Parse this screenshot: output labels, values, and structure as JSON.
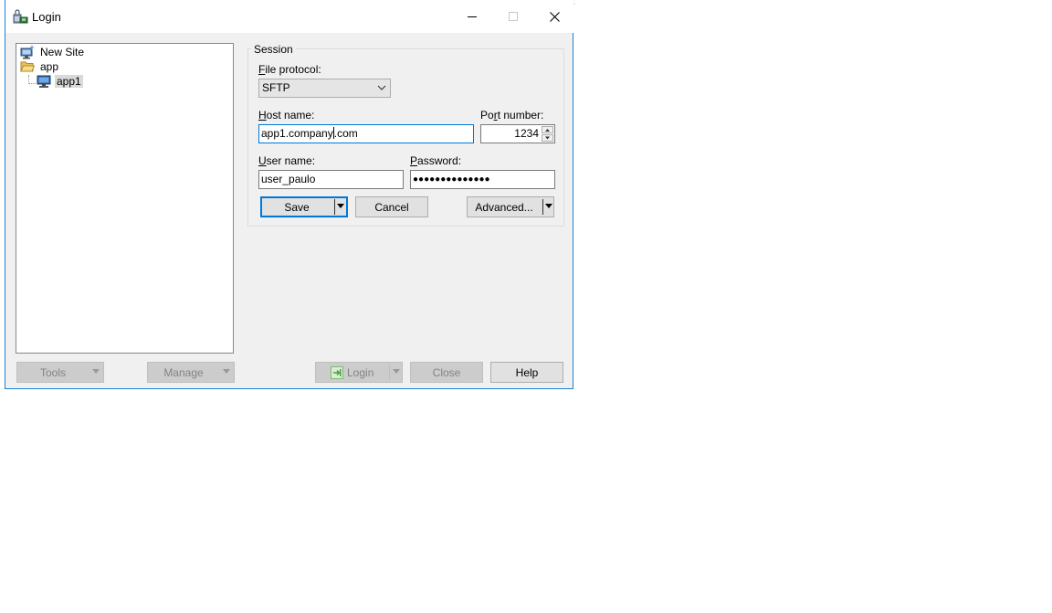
{
  "window": {
    "title": "Login",
    "minimize_icon": "minimize-icon",
    "maximize_icon": "maximize-icon",
    "close_icon": "close-icon"
  },
  "site_tree": {
    "items": [
      {
        "label": "New Site",
        "icon": "new-site-icon",
        "level": 0,
        "selected": false
      },
      {
        "label": "app",
        "icon": "folder-open-icon",
        "level": 0,
        "selected": false
      },
      {
        "label": "app1",
        "icon": "computer-icon",
        "level": 1,
        "selected": true
      }
    ]
  },
  "session": {
    "group_title": "Session",
    "file_protocol": {
      "label_accel": "F",
      "label_rest": "ile protocol:",
      "value": "SFTP"
    },
    "host_name": {
      "label_accel": "H",
      "label_rest": "ost name:",
      "value_before_caret": "app1.company",
      "value_after_caret": ".com"
    },
    "port_number": {
      "label_pre": "Po",
      "label_accel": "r",
      "label_rest": "t number:",
      "value": "1234"
    },
    "user_name": {
      "label_accel": "U",
      "label_rest": "ser name:",
      "value": "user_paulo"
    },
    "password": {
      "label_accel": "P",
      "label_rest": "assword:",
      "value": "●●●●●●●●●●●●●●"
    },
    "save_label": "Save",
    "cancel_label": "Cancel",
    "advanced_label": "Advanced..."
  },
  "footer": {
    "tools_label": "Tools",
    "manage_label": "Manage",
    "login_label": "Login",
    "close_label": "Close",
    "help_label": "Help"
  },
  "colors": {
    "window_bg": "#f0f0f0",
    "focus_blue": "#0078d7",
    "window_border": "#1883d7"
  }
}
